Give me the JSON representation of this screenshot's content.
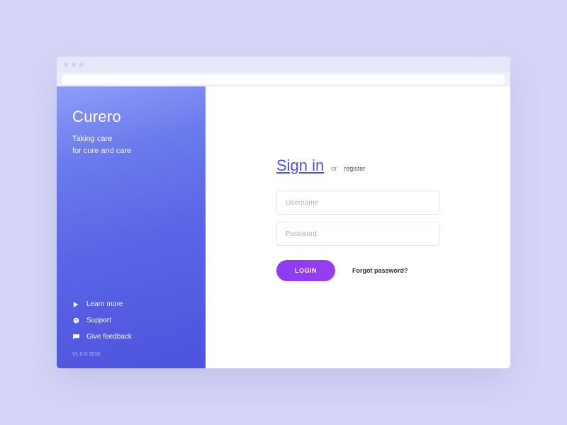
{
  "sidebar": {
    "brand": "Curero",
    "tagline_line1": "Taking care",
    "tagline_line2": "for cure and care",
    "links": [
      {
        "label": "Learn more",
        "icon": "play"
      },
      {
        "label": "Support",
        "icon": "help"
      },
      {
        "label": "Give feedback",
        "icon": "chat"
      }
    ],
    "version": "V1.0  © 2018"
  },
  "auth": {
    "signin_label": "Sign in",
    "or_text": "or",
    "register_label": "register",
    "username_placeholder": "Username",
    "password_placeholder": "Password",
    "login_button": "LOGIN",
    "forgot_label": "Forgot password?"
  }
}
